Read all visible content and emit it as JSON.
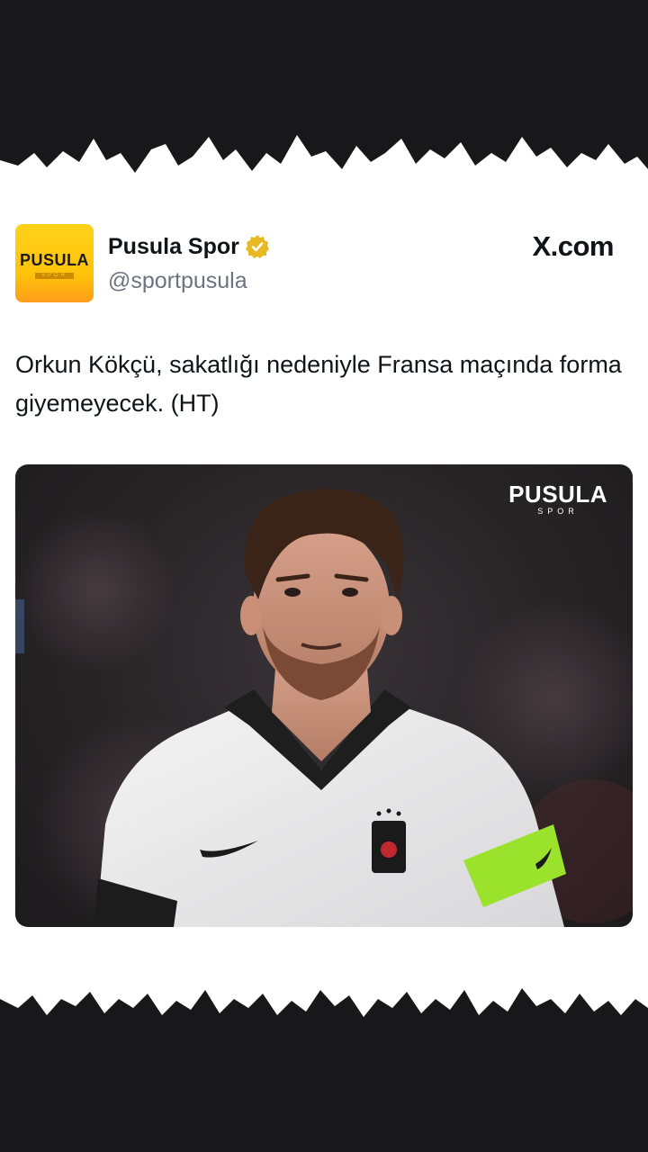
{
  "post": {
    "display_name": "Pusula Spor",
    "handle": "@sportpusula",
    "site": "X.com",
    "text": "Orkun Kökçü, sakatlığı nedeniyle Fransa maçında forma giyemeyecek. (HT)",
    "verified": true
  },
  "avatar": {
    "logo_text": "PUSULA",
    "logo_sub": "SPOR"
  },
  "media": {
    "watermark_main": "PUSULA",
    "watermark_sub": "SPOR"
  },
  "colors": {
    "background": "#18181a",
    "card": "#ffffff",
    "verified_badge": "#e8b923",
    "avatar_yellow": "#ffc20a",
    "armband": "#9be22d"
  },
  "icons": {
    "verified": "verified-badge-icon"
  }
}
